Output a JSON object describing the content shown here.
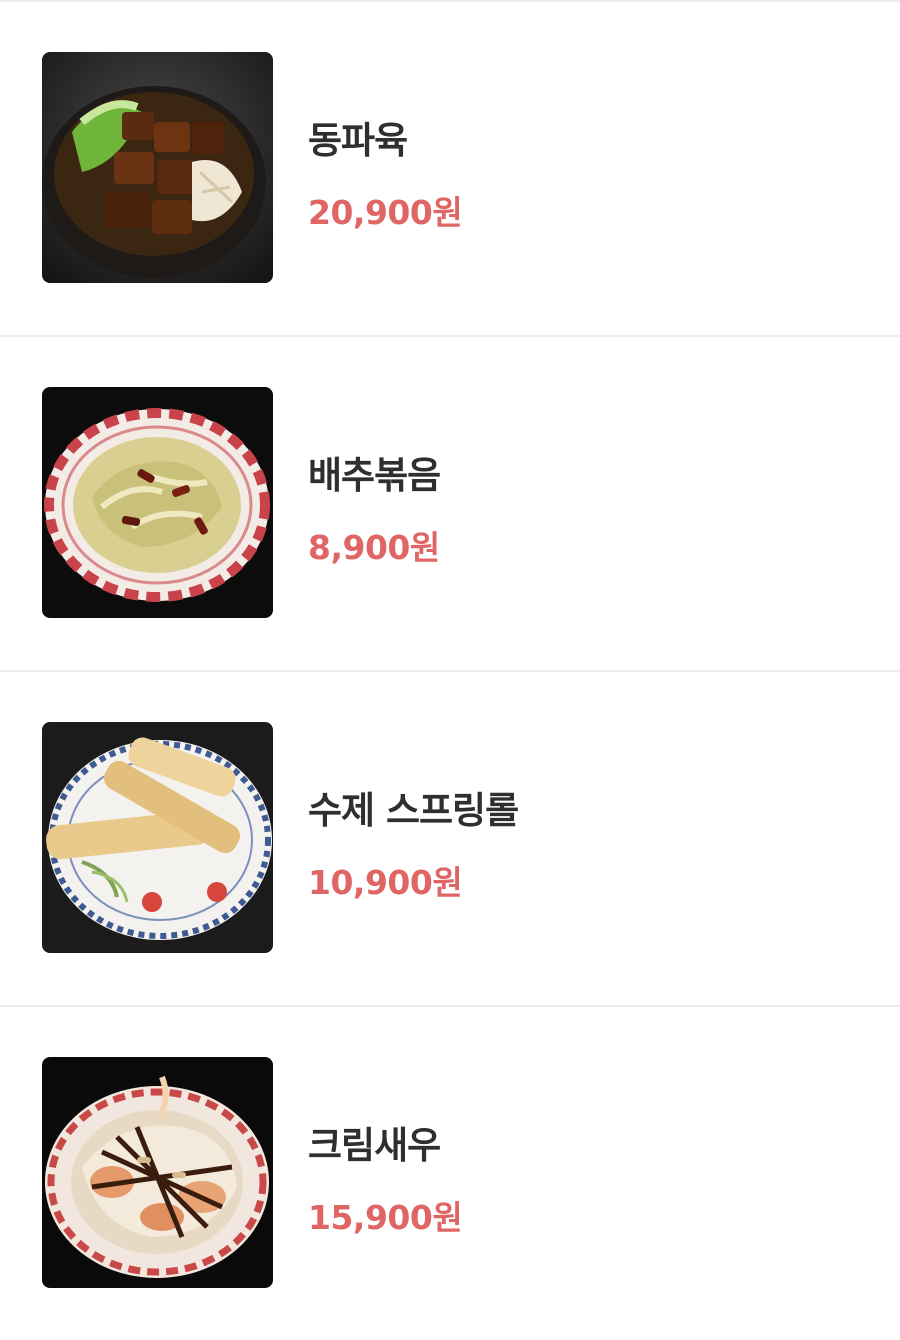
{
  "accent_price_color": "#e06565",
  "menu": {
    "items": [
      {
        "name": "동파육",
        "price": "20,900원",
        "photo_icon": "braised-pork-dish-photo"
      },
      {
        "name": "배추볶음",
        "price": "8,900원",
        "photo_icon": "stir-fried-cabbage-photo"
      },
      {
        "name": "수제 스프링롤",
        "price": "10,900원",
        "photo_icon": "spring-roll-photo"
      },
      {
        "name": "크림새우",
        "price": "15,900원",
        "photo_icon": "cream-shrimp-photo"
      }
    ]
  }
}
